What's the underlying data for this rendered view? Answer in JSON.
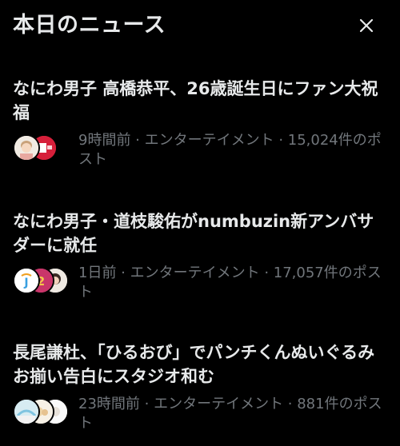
{
  "header": {
    "title": "本日のニュース",
    "close_icon": "close-icon"
  },
  "news": [
    {
      "title": "なにわ男子 高橋恭平、26歳誕生日にファン大祝福",
      "meta": "9時間前 · エンターテイメント · 15,024件のポスト"
    },
    {
      "title": "なにわ男子・道枝駿佑がnumbuzin新アンバサダーに就任",
      "meta": "1日前 · エンターテイメント · 17,057件のポスト"
    },
    {
      "title": "長尾謙杜、「ひるおび」でパンチくんぬいぐるみお揃い告白にスタジオ和む",
      "meta": "23時間前 · エンターテイメント · 881件のポスト"
    }
  ],
  "colors": {
    "background": "#000000",
    "title_text": "#e7e9ea",
    "meta_text": "#71767b"
  }
}
